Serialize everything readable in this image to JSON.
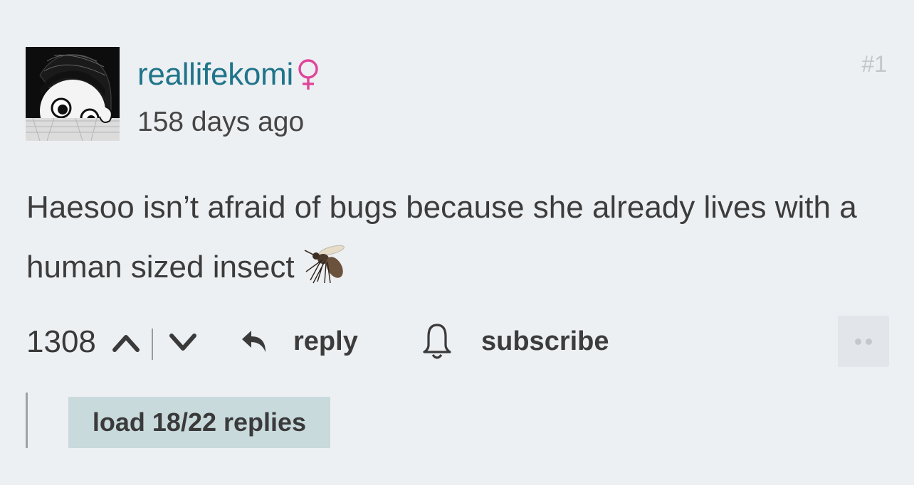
{
  "comment": {
    "username": "reallifekomi",
    "gender_icon": "female-symbol-icon",
    "timestamp": "158 days ago",
    "post_number": "#1",
    "body": "Haesoo isn’t afraid of bugs because she already lives with a human sized insect",
    "body_emoji_icon": "mosquito-icon",
    "avatar": "anime-girl-avatar",
    "accent_color": "#1f7489",
    "gender_color": "#e0449a"
  },
  "actions": {
    "score": "1308",
    "upvote_icon": "chevron-up-icon",
    "downvote_icon": "chevron-down-icon",
    "reply_label": "reply",
    "reply_icon": "reply-arrow-icon",
    "subscribe_label": "subscribe",
    "subscribe_icon": "bell-icon",
    "more_icon": "more-dots-icon"
  },
  "replies": {
    "load_label": "load 18/22 replies",
    "button_color": "#c9dadd"
  }
}
